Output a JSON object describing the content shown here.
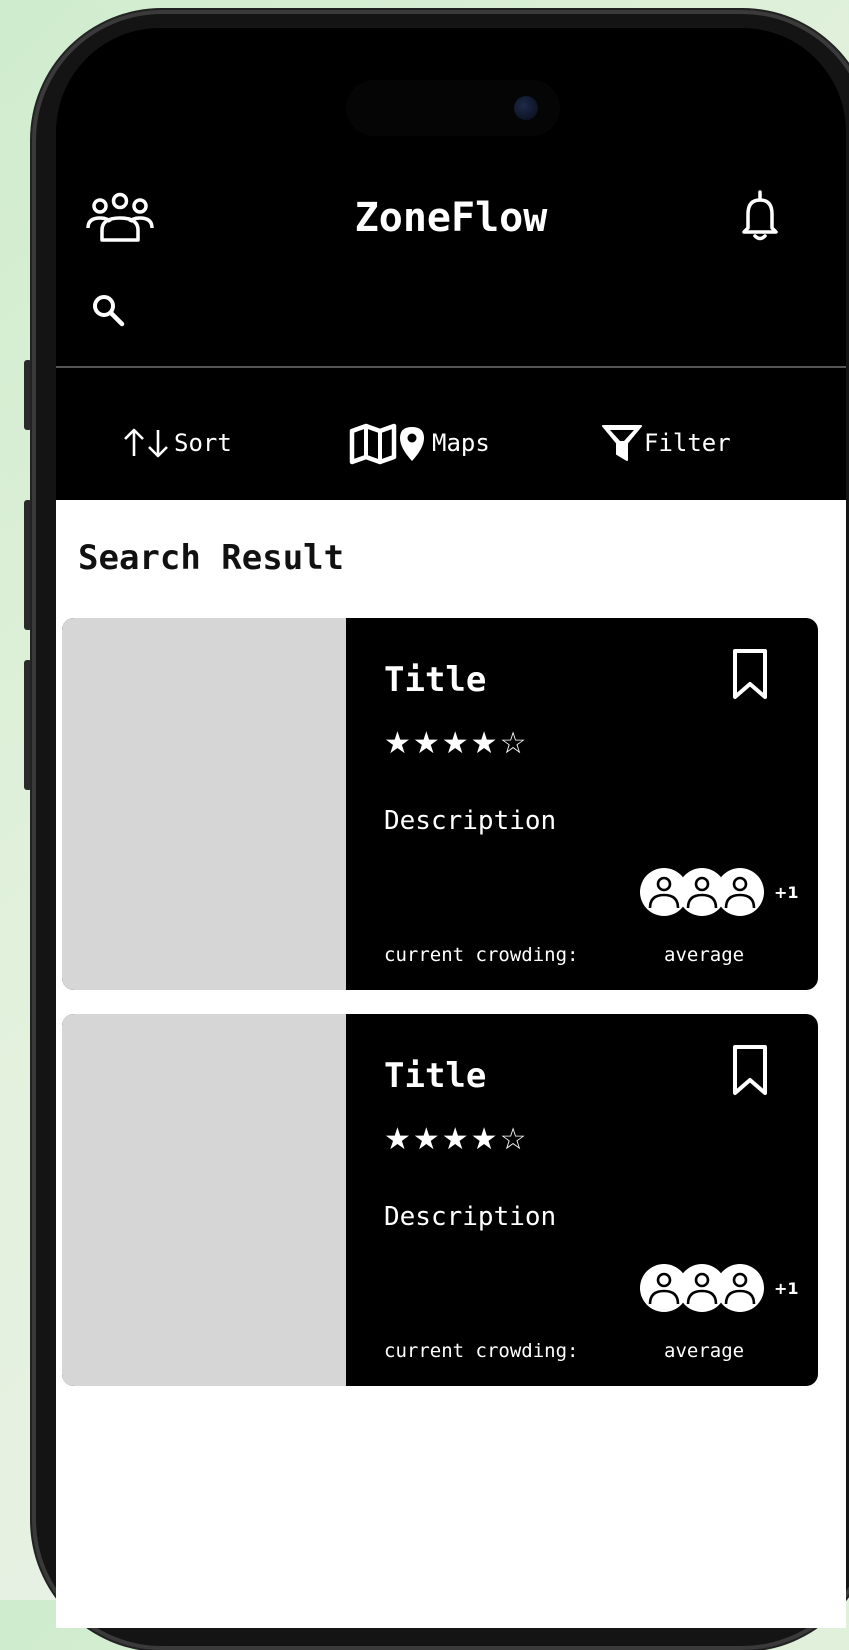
{
  "app": {
    "title": "ZoneFlow"
  },
  "search": {
    "value": "",
    "placeholder": ""
  },
  "toolbar": {
    "sort_label": "Sort",
    "maps_label": "Maps",
    "filter_label": "Filter"
  },
  "results": {
    "heading": "Search Result",
    "items": [
      {
        "title": "Title",
        "rating": 4,
        "rating_max": 5,
        "stars": "★★★★☆",
        "description": "Description",
        "crowd_extra": "+1",
        "crowding_label": "current crowding:",
        "crowding_value": "average"
      },
      {
        "title": "Title",
        "rating": 4,
        "rating_max": 5,
        "stars": "★★★★☆",
        "description": "Description",
        "crowd_extra": "+1",
        "crowding_label": "current crowding:",
        "crowding_value": "average"
      }
    ]
  },
  "icons": {
    "users": "users-icon",
    "bell": "bell-icon",
    "search": "search-icon",
    "sort": "sort-arrows-icon",
    "maps": "map-pin-icon",
    "filter": "filter-funnel-icon",
    "bookmark": "bookmark-icon",
    "crowd": "crowd-avatars-icon"
  },
  "colors": {
    "background": "#000000",
    "card": "#000000",
    "image_placeholder": "#d6d6d6",
    "text": "#ffffff",
    "content_bg": "#ffffff"
  }
}
